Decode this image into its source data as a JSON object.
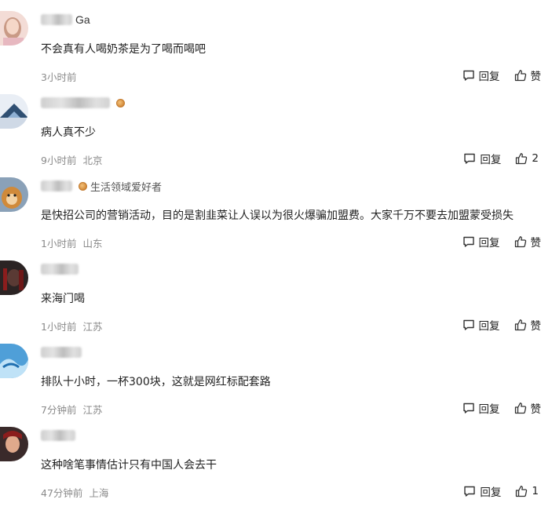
{
  "comments": [
    {
      "name": "Ga",
      "badge": "",
      "text": "不会真有人喝奶茶是为了喝而喝吧",
      "time": "3小时前",
      "location": "",
      "reply_label": "回复",
      "like_label": "赞"
    },
    {
      "name": "",
      "badge": "",
      "text": "病人真不少",
      "time": "9小时前",
      "location": "北京",
      "reply_label": "回复",
      "like_label": "2"
    },
    {
      "name": "",
      "badge": "生活领域爱好者",
      "text": "是快招公司的营销活动，目的是割韭菜让人误以为很火爆骗加盟费。大家千万不要去加盟蒙受损失",
      "time": "1小时前",
      "location": "山东",
      "reply_label": "回复",
      "like_label": "赞"
    },
    {
      "name": "",
      "badge": "",
      "text": "来海门喝",
      "time": "1小时前",
      "location": "江苏",
      "reply_label": "回复",
      "like_label": "赞"
    },
    {
      "name": "",
      "badge": "",
      "text": "排队十小时，一杯300块，这就是网红标配套路",
      "time": "7分钟前",
      "location": "江苏",
      "reply_label": "回复",
      "like_label": "赞"
    },
    {
      "name": "",
      "badge": "",
      "text": "这种啥笔事情估计只有中国人会去干",
      "time": "47分钟前",
      "location": "上海",
      "reply_label": "回复",
      "like_label": "1"
    }
  ],
  "icons": {
    "reply": "comment-bubble-icon",
    "like": "thumbs-up-icon",
    "badge": "level-badge-icon"
  },
  "colors": {
    "meta_text": "#8a8a8a",
    "badge": "#d38a3a"
  }
}
